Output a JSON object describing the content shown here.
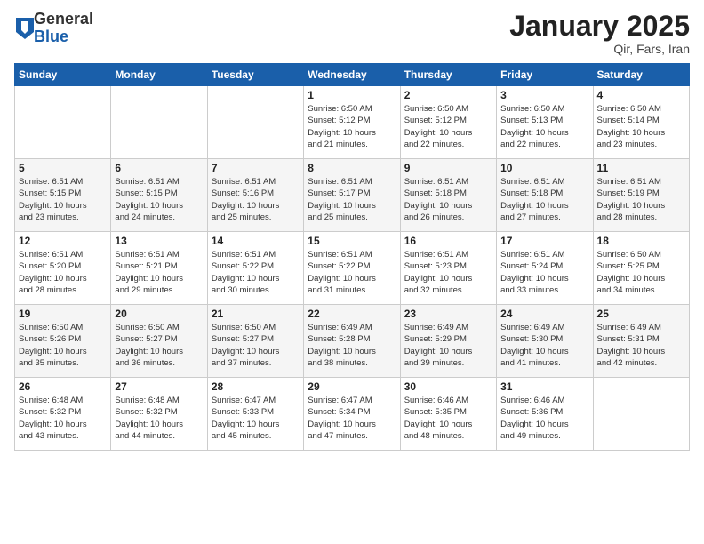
{
  "logo": {
    "general": "General",
    "blue": "Blue"
  },
  "title": "January 2025",
  "location": "Qir, Fars, Iran",
  "days_header": [
    "Sunday",
    "Monday",
    "Tuesday",
    "Wednesday",
    "Thursday",
    "Friday",
    "Saturday"
  ],
  "weeks": [
    [
      {
        "day": "",
        "info": ""
      },
      {
        "day": "",
        "info": ""
      },
      {
        "day": "",
        "info": ""
      },
      {
        "day": "1",
        "info": "Sunrise: 6:50 AM\nSunset: 5:12 PM\nDaylight: 10 hours\nand 21 minutes."
      },
      {
        "day": "2",
        "info": "Sunrise: 6:50 AM\nSunset: 5:12 PM\nDaylight: 10 hours\nand 22 minutes."
      },
      {
        "day": "3",
        "info": "Sunrise: 6:50 AM\nSunset: 5:13 PM\nDaylight: 10 hours\nand 22 minutes."
      },
      {
        "day": "4",
        "info": "Sunrise: 6:50 AM\nSunset: 5:14 PM\nDaylight: 10 hours\nand 23 minutes."
      }
    ],
    [
      {
        "day": "5",
        "info": "Sunrise: 6:51 AM\nSunset: 5:15 PM\nDaylight: 10 hours\nand 23 minutes."
      },
      {
        "day": "6",
        "info": "Sunrise: 6:51 AM\nSunset: 5:15 PM\nDaylight: 10 hours\nand 24 minutes."
      },
      {
        "day": "7",
        "info": "Sunrise: 6:51 AM\nSunset: 5:16 PM\nDaylight: 10 hours\nand 25 minutes."
      },
      {
        "day": "8",
        "info": "Sunrise: 6:51 AM\nSunset: 5:17 PM\nDaylight: 10 hours\nand 25 minutes."
      },
      {
        "day": "9",
        "info": "Sunrise: 6:51 AM\nSunset: 5:18 PM\nDaylight: 10 hours\nand 26 minutes."
      },
      {
        "day": "10",
        "info": "Sunrise: 6:51 AM\nSunset: 5:18 PM\nDaylight: 10 hours\nand 27 minutes."
      },
      {
        "day": "11",
        "info": "Sunrise: 6:51 AM\nSunset: 5:19 PM\nDaylight: 10 hours\nand 28 minutes."
      }
    ],
    [
      {
        "day": "12",
        "info": "Sunrise: 6:51 AM\nSunset: 5:20 PM\nDaylight: 10 hours\nand 28 minutes."
      },
      {
        "day": "13",
        "info": "Sunrise: 6:51 AM\nSunset: 5:21 PM\nDaylight: 10 hours\nand 29 minutes."
      },
      {
        "day": "14",
        "info": "Sunrise: 6:51 AM\nSunset: 5:22 PM\nDaylight: 10 hours\nand 30 minutes."
      },
      {
        "day": "15",
        "info": "Sunrise: 6:51 AM\nSunset: 5:22 PM\nDaylight: 10 hours\nand 31 minutes."
      },
      {
        "day": "16",
        "info": "Sunrise: 6:51 AM\nSunset: 5:23 PM\nDaylight: 10 hours\nand 32 minutes."
      },
      {
        "day": "17",
        "info": "Sunrise: 6:51 AM\nSunset: 5:24 PM\nDaylight: 10 hours\nand 33 minutes."
      },
      {
        "day": "18",
        "info": "Sunrise: 6:50 AM\nSunset: 5:25 PM\nDaylight: 10 hours\nand 34 minutes."
      }
    ],
    [
      {
        "day": "19",
        "info": "Sunrise: 6:50 AM\nSunset: 5:26 PM\nDaylight: 10 hours\nand 35 minutes."
      },
      {
        "day": "20",
        "info": "Sunrise: 6:50 AM\nSunset: 5:27 PM\nDaylight: 10 hours\nand 36 minutes."
      },
      {
        "day": "21",
        "info": "Sunrise: 6:50 AM\nSunset: 5:27 PM\nDaylight: 10 hours\nand 37 minutes."
      },
      {
        "day": "22",
        "info": "Sunrise: 6:49 AM\nSunset: 5:28 PM\nDaylight: 10 hours\nand 38 minutes."
      },
      {
        "day": "23",
        "info": "Sunrise: 6:49 AM\nSunset: 5:29 PM\nDaylight: 10 hours\nand 39 minutes."
      },
      {
        "day": "24",
        "info": "Sunrise: 6:49 AM\nSunset: 5:30 PM\nDaylight: 10 hours\nand 41 minutes."
      },
      {
        "day": "25",
        "info": "Sunrise: 6:49 AM\nSunset: 5:31 PM\nDaylight: 10 hours\nand 42 minutes."
      }
    ],
    [
      {
        "day": "26",
        "info": "Sunrise: 6:48 AM\nSunset: 5:32 PM\nDaylight: 10 hours\nand 43 minutes."
      },
      {
        "day": "27",
        "info": "Sunrise: 6:48 AM\nSunset: 5:32 PM\nDaylight: 10 hours\nand 44 minutes."
      },
      {
        "day": "28",
        "info": "Sunrise: 6:47 AM\nSunset: 5:33 PM\nDaylight: 10 hours\nand 45 minutes."
      },
      {
        "day": "29",
        "info": "Sunrise: 6:47 AM\nSunset: 5:34 PM\nDaylight: 10 hours\nand 47 minutes."
      },
      {
        "day": "30",
        "info": "Sunrise: 6:46 AM\nSunset: 5:35 PM\nDaylight: 10 hours\nand 48 minutes."
      },
      {
        "day": "31",
        "info": "Sunrise: 6:46 AM\nSunset: 5:36 PM\nDaylight: 10 hours\nand 49 minutes."
      },
      {
        "day": "",
        "info": ""
      }
    ]
  ]
}
